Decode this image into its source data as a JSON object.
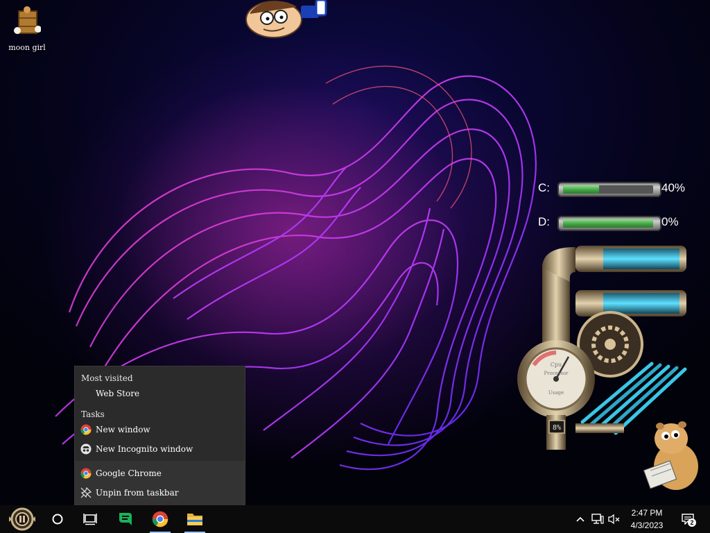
{
  "desktop": {
    "icons": [
      {
        "label": "moon girl",
        "icon": "wooden-box-icon"
      }
    ],
    "widgets": {
      "drives": [
        {
          "letter": "C:",
          "percent": "40%",
          "used_fraction": 0.4
        },
        {
          "letter": "D:",
          "percent": "0%",
          "used_fraction": 1.0
        }
      ],
      "cpu_gauge": {
        "value": "8%",
        "dial_text": [
          "Cpu",
          "Processor",
          "Usage"
        ]
      },
      "decorations": [
        "cartoon-face-sticker",
        "steampunk-pipes-meter",
        "hamster-reading-sticker"
      ]
    }
  },
  "jumplist": {
    "sections": {
      "most_visited": "Most visited",
      "tasks": "Tasks"
    },
    "most_visited": [
      {
        "label": "Web Store"
      }
    ],
    "tasks": [
      {
        "label": "New window",
        "icon": "chrome-icon"
      },
      {
        "label": "New Incognito window",
        "icon": "incognito-icon"
      }
    ],
    "app": {
      "label": "Google Chrome",
      "icon": "chrome-icon"
    },
    "unpin": {
      "label": "Unpin from taskbar",
      "icon": "unpin-icon"
    }
  },
  "taskbar": {
    "start_icon": "steampunk-start-orb",
    "apps": [
      {
        "name": "search",
        "icon": "cortana-circle-icon"
      },
      {
        "name": "task-view",
        "icon": "task-view-icon"
      },
      {
        "name": "green-app",
        "icon": "green-chat-icon"
      },
      {
        "name": "chrome",
        "icon": "chrome-icon"
      },
      {
        "name": "file-explorer",
        "icon": "folder-icon"
      }
    ],
    "tray": {
      "icons": [
        "chevron-up-icon",
        "network-icon",
        "volume-muted-icon"
      ],
      "time": "2:47 PM",
      "date": "4/3/2023",
      "notifications_count": "2"
    }
  },
  "colors": {
    "accent": "#9cc4ff",
    "jumplist_bg": "#2b2b2b",
    "taskbar_bg": "#0b0b0c",
    "meter_green": "#3f9f3f",
    "tube_cyan": "#3bc6e6"
  }
}
